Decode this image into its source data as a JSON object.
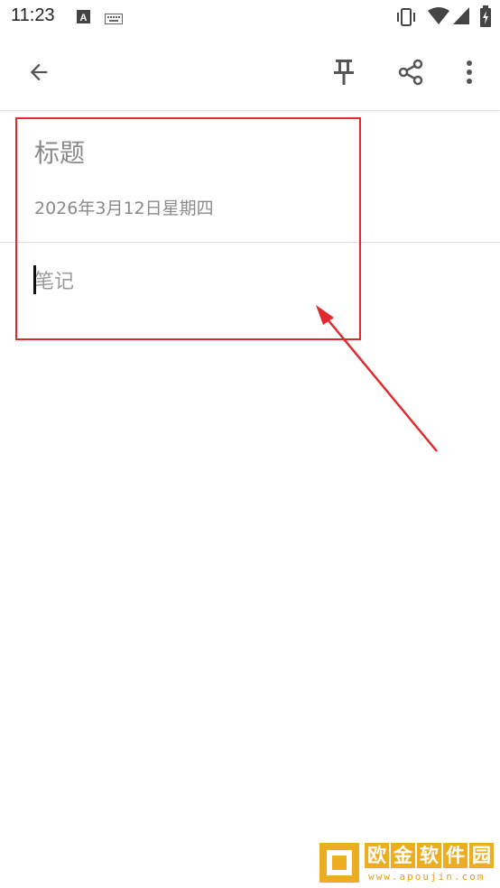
{
  "status_bar": {
    "time": "11:23"
  },
  "toolbar": {
    "icons": [
      "back-arrow-icon",
      "pin-icon",
      "share-icon",
      "more-vert-icon"
    ]
  },
  "note": {
    "title_placeholder": "标题",
    "date": "2026年3月12日星期四",
    "body_placeholder": "笔记"
  },
  "annotation": {
    "color": "#e02a2e"
  },
  "watermark": {
    "chars": [
      "欧",
      "金",
      "软",
      "件",
      "园"
    ],
    "url": "www.apoujin.com",
    "color": "#ecae20"
  }
}
